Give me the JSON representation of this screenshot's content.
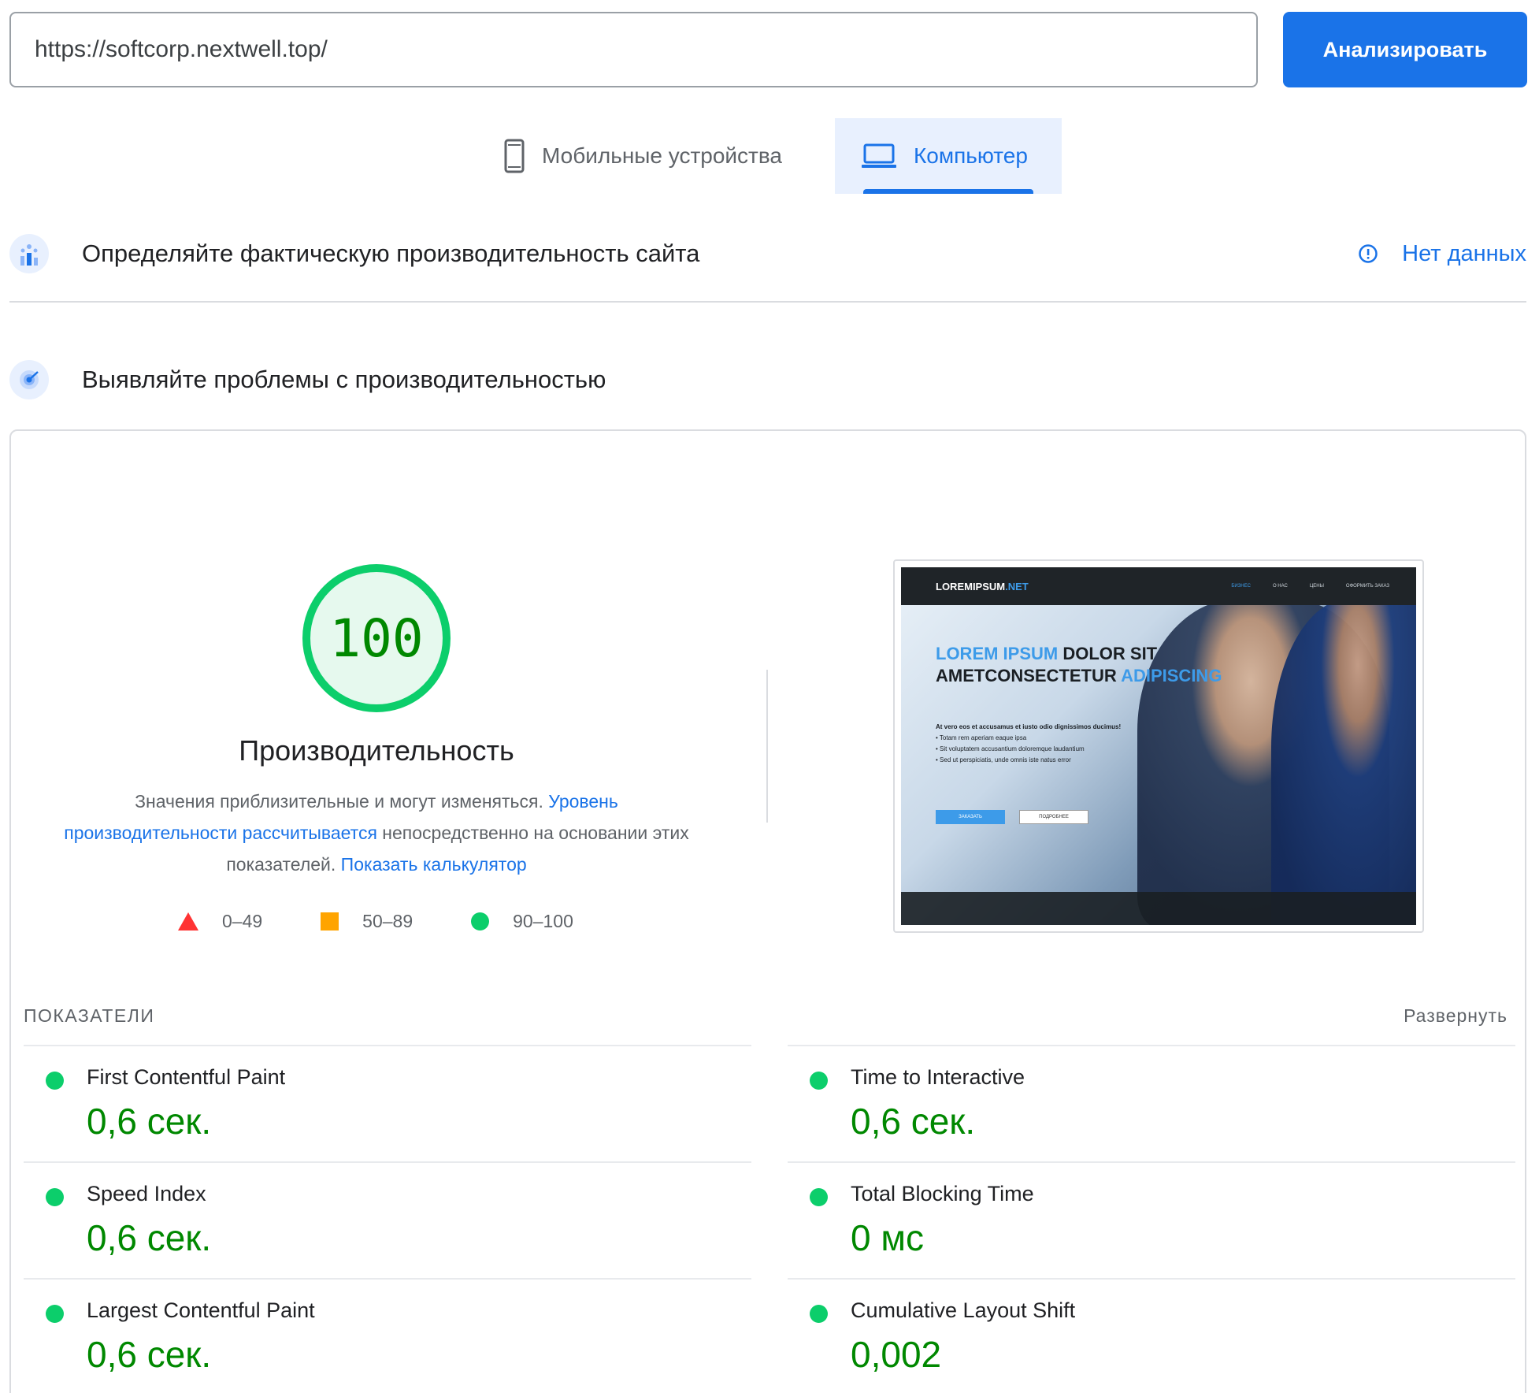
{
  "search": {
    "url_value": "https://softcorp.nextwell.top/",
    "analyze_label": "Анализировать"
  },
  "tabs": [
    {
      "label": "Мобильные устройства",
      "icon": "smartphone-icon",
      "active": false
    },
    {
      "label": "Компьютер",
      "icon": "laptop-icon",
      "active": true
    }
  ],
  "field_section": {
    "icon": "field-data-icon",
    "title": "Определяйте фактическую производительность сайта",
    "no_data_label": "Нет данных",
    "no_data_icon": "info-icon"
  },
  "lab_section": {
    "icon": "diagnose-icon",
    "title": "Выявляйте проблемы с производительностью"
  },
  "score": {
    "value": "100",
    "fraction": 1.0,
    "title": "Производительность",
    "desc_prefix": "Значения приблизительные и могут изменяться.",
    "desc_link": "Уровень производительности рассчитывается",
    "desc_middle": "непосредственно на основании этих показателей.",
    "desc_calc_link": "Показать калькулятор",
    "color": "#0cce6b"
  },
  "legend": [
    {
      "label": "0–49",
      "shape": "triangle",
      "color": "#ff3333"
    },
    {
      "label": "50–89",
      "shape": "square",
      "color": "#ffa400"
    },
    {
      "label": "90–100",
      "shape": "circle",
      "color": "#0cce6b"
    }
  ],
  "thumbnail": {
    "logo_main": "LOREMIPSUM",
    "logo_accent": ".NET",
    "menu": [
      "БИЗНЕС",
      "О НАС",
      "ЦЕНЫ",
      "ОФОРМИТЬ ЗАКАЗ"
    ],
    "headline_1a": "LOREM IPSUM",
    "headline_1b": " DOLOR SIT",
    "headline_2a": "AMETCONSECTETUR ",
    "headline_2b": "ADIPISCING",
    "lead": "At vero eos et accusamus et iusto odio dignissimos ducimus!",
    "bullets": [
      "Totam rem aperiam eaque ipsa",
      "Sit voluptatem accusantium doloremque laudantium",
      "Sed ut perspiciatis, unde omnis iste natus error"
    ],
    "btn_primary": "ЗАКАЗАТЬ",
    "btn_secondary": "ПОДРОБНЕЕ"
  },
  "metrics": {
    "section_label": "ПОКАЗАТЕЛИ",
    "expand_label": "Развернуть",
    "items": [
      {
        "name": "First Contentful Paint",
        "value": "0,6 сек."
      },
      {
        "name": "Time to Interactive",
        "value": "0,6 сек."
      },
      {
        "name": "Speed Index",
        "value": "0,6 сек."
      },
      {
        "name": "Total Blocking Time",
        "value": "0 мс"
      },
      {
        "name": "Largest Contentful Paint",
        "value": "0,6 сек."
      },
      {
        "name": "Cumulative Layout Shift",
        "value": "0,002"
      }
    ]
  },
  "colors": {
    "accent": "#1a73e8",
    "good": "#0cce6b",
    "good_text": "#008800"
  }
}
